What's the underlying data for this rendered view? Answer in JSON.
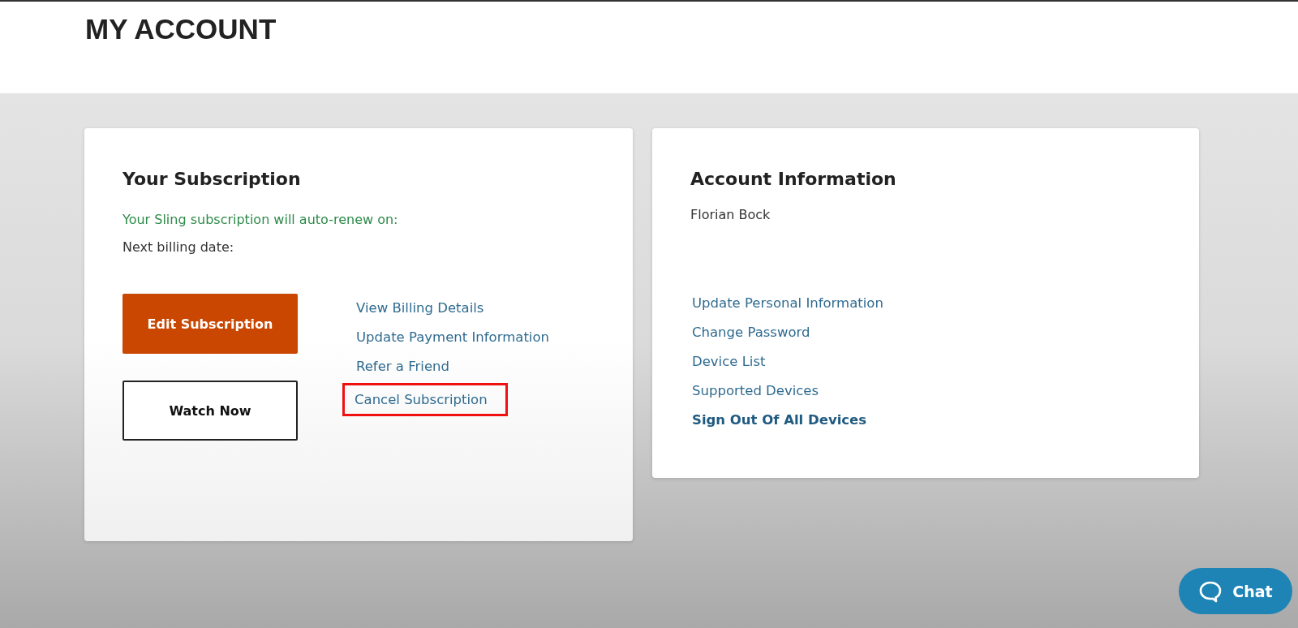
{
  "header": {
    "title": "MY ACCOUNT"
  },
  "subscription": {
    "title": "Your Subscription",
    "renew_text": "Your Sling subscription will auto-renew on:",
    "billing_label": "Next billing date:",
    "buttons": [
      {
        "label": "Edit Subscription",
        "kind": "primary"
      },
      {
        "label": "Watch Now",
        "kind": "outline"
      }
    ],
    "links": [
      {
        "label": "View Billing Details",
        "highlighted": false
      },
      {
        "label": "Update Payment Information",
        "highlighted": false
      },
      {
        "label": "Refer a Friend",
        "highlighted": false
      },
      {
        "label": "Cancel Subscription",
        "highlighted": true
      }
    ]
  },
  "account": {
    "title": "Account Information",
    "name": "Florian Bock",
    "links": [
      {
        "label": "Update Personal Information",
        "bold": false
      },
      {
        "label": "Change Password",
        "bold": false
      },
      {
        "label": "Device List",
        "bold": false
      },
      {
        "label": "Supported Devices",
        "bold": false
      },
      {
        "label": "Sign Out Of All Devices",
        "bold": true
      }
    ]
  },
  "chat": {
    "label": "Chat"
  }
}
